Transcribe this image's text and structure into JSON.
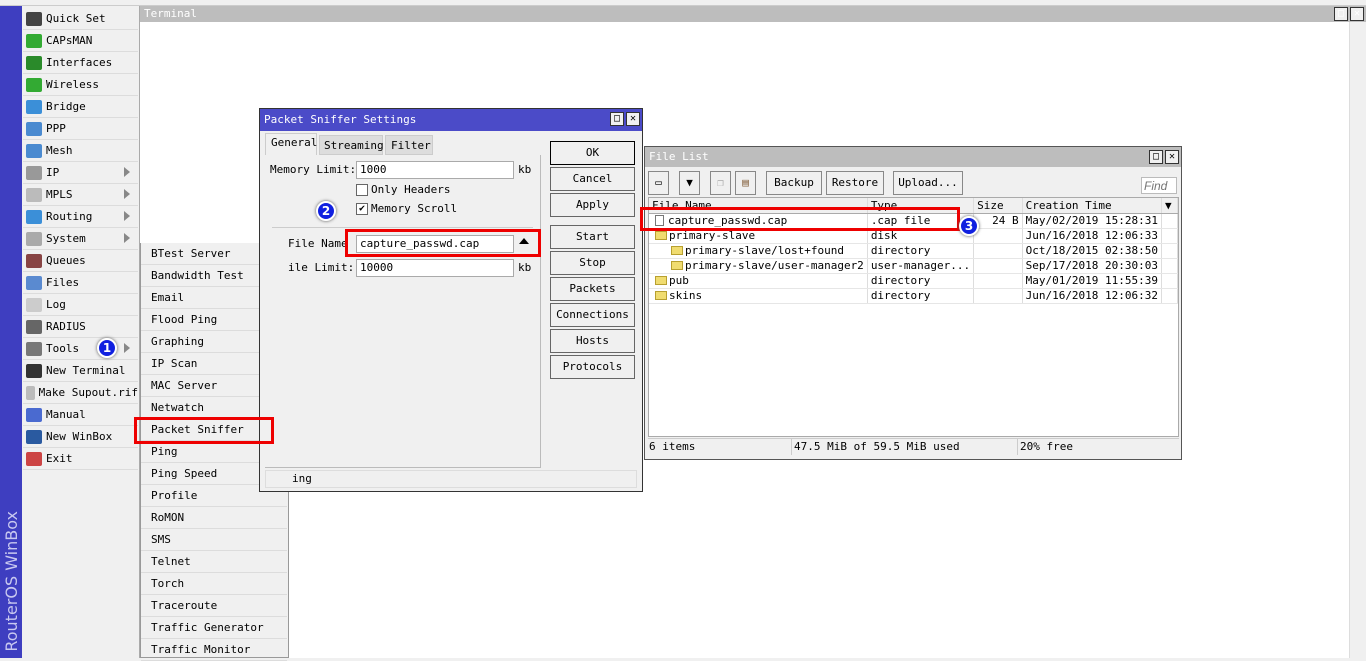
{
  "brand": "RouterOS WinBox",
  "menu": [
    {
      "label": "Quick Set",
      "icon": "wand-icon",
      "color": "#444"
    },
    {
      "label": "CAPsMAN",
      "icon": "antenna-icon",
      "color": "#3a3"
    },
    {
      "label": "Interfaces",
      "icon": "network-card-icon",
      "color": "#2a8a2a"
    },
    {
      "label": "Wireless",
      "icon": "antenna-icon",
      "color": "#3a3"
    },
    {
      "label": "Bridge",
      "icon": "bridge-icon",
      "color": "#3b8fd8"
    },
    {
      "label": "PPP",
      "icon": "ppp-icon",
      "color": "#4a8ad0"
    },
    {
      "label": "Mesh",
      "icon": "mesh-icon",
      "color": "#4a8ad0"
    },
    {
      "label": "IP",
      "icon": "ip-icon",
      "color": "#999",
      "submenu": true
    },
    {
      "label": "MPLS",
      "icon": "mpls-icon",
      "color": "#bbb",
      "submenu": true
    },
    {
      "label": "Routing",
      "icon": "routing-icon",
      "color": "#3b8fd8",
      "submenu": true
    },
    {
      "label": "System",
      "icon": "gear-icon",
      "color": "#aaa",
      "submenu": true
    },
    {
      "label": "Queues",
      "icon": "queues-icon",
      "color": "#844"
    },
    {
      "label": "Files",
      "icon": "folder-icon",
      "color": "#5a8ad0"
    },
    {
      "label": "Log",
      "icon": "log-icon",
      "color": "#ccc"
    },
    {
      "label": "RADIUS",
      "icon": "radius-icon",
      "color": "#666"
    },
    {
      "label": "Tools",
      "icon": "tools-icon",
      "color": "#777",
      "submenu": true
    },
    {
      "label": "New Terminal",
      "icon": "terminal-icon",
      "color": "#333"
    },
    {
      "label": "Make Supout.rif",
      "icon": "document-icon",
      "color": "#bbb"
    },
    {
      "label": "Manual",
      "icon": "help-icon",
      "color": "#4a6ad0"
    },
    {
      "label": "New WinBox",
      "icon": "winbox-icon",
      "color": "#2a5aa0"
    },
    {
      "label": "Exit",
      "icon": "exit-icon",
      "color": "#c44"
    }
  ],
  "terminal": {
    "title": "Terminal"
  },
  "tools_submenu": [
    "BTest Server",
    "Bandwidth Test",
    "Email",
    "Flood Ping",
    "Graphing",
    "IP Scan",
    "MAC Server",
    "Netwatch",
    "Packet Sniffer",
    "Ping",
    "Ping Speed",
    "Profile",
    "RoMON",
    "SMS",
    "Telnet",
    "Torch",
    "Traceroute",
    "Traffic Generator",
    "Traffic Monitor"
  ],
  "sniffer": {
    "title": "Packet Sniffer Settings",
    "tabs": [
      "General",
      "Streaming",
      "Filter"
    ],
    "memory_limit_label": "Memory Limit:",
    "memory_limit": "1000",
    "unit": "kb",
    "only_headers_label": "Only Headers",
    "only_headers": false,
    "memory_scroll_label": "Memory Scroll",
    "memory_scroll": true,
    "file_name_label": "File Name",
    "file_name": "capture_passwd.cap",
    "file_limit_label": "ile Limit:",
    "file_limit": "10000",
    "buttons": [
      "OK",
      "Cancel",
      "Apply",
      "Start",
      "Stop",
      "Packets",
      "Connections",
      "Hosts",
      "Protocols"
    ],
    "status": "ing"
  },
  "filelist": {
    "title": "File List",
    "toolbar": {
      "backup": "Backup",
      "restore": "Restore",
      "upload": "Upload...",
      "find_placeholder": "Find"
    },
    "columns": [
      "File Name",
      "Type",
      "Size",
      "Creation Time"
    ],
    "rows": [
      {
        "name": "capture_passwd.cap",
        "type": ".cap file",
        "size": "24 B",
        "time": "May/02/2019 15:28:31",
        "kind": "file",
        "indent": 0
      },
      {
        "name": "primary-slave",
        "type": "disk",
        "size": "",
        "time": "Jun/16/2018 12:06:33",
        "kind": "folder",
        "indent": 0
      },
      {
        "name": "primary-slave/lost+found",
        "type": "directory",
        "size": "",
        "time": "Oct/18/2015 02:38:50",
        "kind": "folder",
        "indent": 1
      },
      {
        "name": "primary-slave/user-manager2",
        "type": "user-manager...",
        "size": "",
        "time": "Sep/17/2018 20:30:03",
        "kind": "folder",
        "indent": 1
      },
      {
        "name": "pub",
        "type": "directory",
        "size": "",
        "time": "May/01/2019 11:55:39",
        "kind": "folder",
        "indent": 0
      },
      {
        "name": "skins",
        "type": "directory",
        "size": "",
        "time": "Jun/16/2018 12:06:32",
        "kind": "folder",
        "indent": 0
      }
    ],
    "status": {
      "items": "6 items",
      "used": "47.5 MiB of 59.5 MiB used",
      "free": "20% free"
    }
  },
  "badges": [
    "1",
    "2",
    "3"
  ],
  "colors": {
    "title_active": "#4b4bc8",
    "title_inactive": "#bdbdbd",
    "highlight": "#e00000",
    "badge": "#1020e0"
  }
}
